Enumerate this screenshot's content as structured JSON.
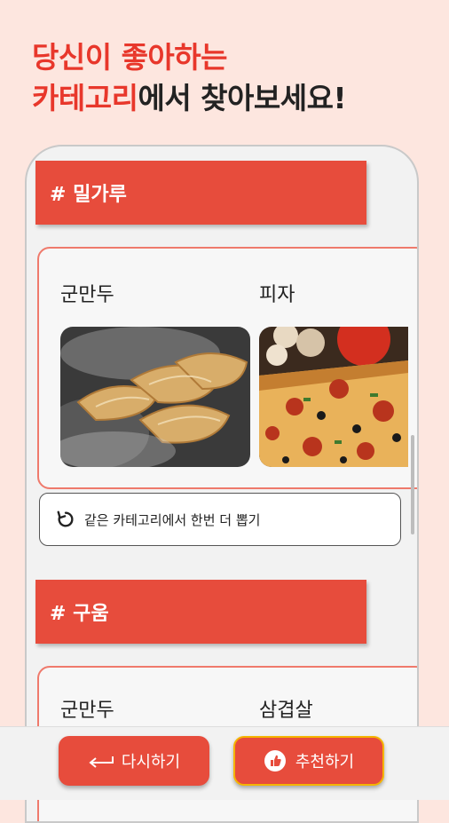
{
  "headline": {
    "line1_red": "당신이 좋아하는",
    "line2_red": "카테고리",
    "line2_dark": "에서 찾아보세요!"
  },
  "sections": [
    {
      "title": "# 밀가루",
      "items": [
        {
          "name": "군만두",
          "image": "dumplings-photo"
        },
        {
          "name": "피자",
          "image": "pizza-photo"
        }
      ],
      "retry_label": "같은 카테고리에서 한번 더 뽑기"
    },
    {
      "title": "# 구움",
      "items": [
        {
          "name": "군만두"
        },
        {
          "name": "삼겹살"
        }
      ]
    }
  ],
  "bottom": {
    "retry_button": "다시하기",
    "recommend_button": "추천하기"
  },
  "colors": {
    "accent_red": "#e74c3c",
    "background": "#fde6df",
    "recommend_border": "#f5b400"
  }
}
